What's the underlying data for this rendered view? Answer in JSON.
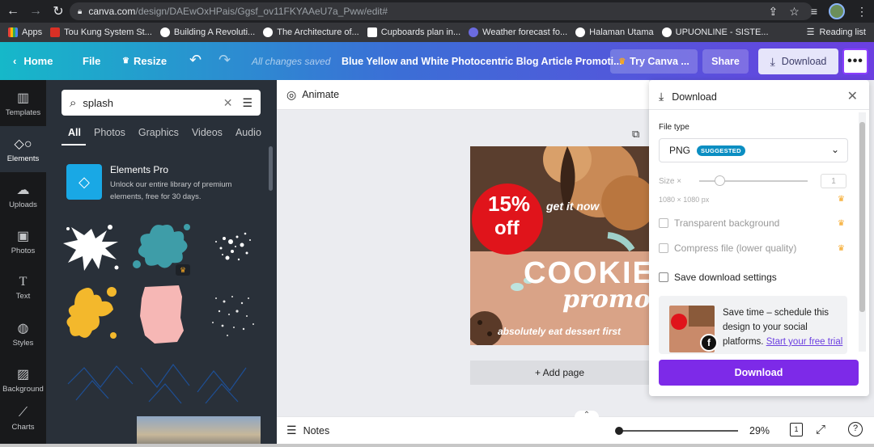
{
  "browser": {
    "url_host": "canva.com",
    "url_path": "/design/DAEwOxHPais/Ggsf_ov11FKYAAeU7a_Pww/edit#",
    "bookmarks": [
      {
        "label": "Apps",
        "color": "#e8eaed"
      },
      {
        "label": "Tou Kung System St...",
        "color": "#d93025"
      },
      {
        "label": "Building A Revoluti...",
        "color": "#4285f4"
      },
      {
        "label": "The Architecture of...",
        "color": "#4285f4"
      },
      {
        "label": "Cupboards plan in...",
        "color": "#ffffff"
      },
      {
        "label": "Weather forecast fo...",
        "color": "#6b6be0"
      },
      {
        "label": "Halaman Utama",
        "color": "#ffffff"
      },
      {
        "label": "UPUONLINE - SISTE...",
        "color": "#ffffff"
      }
    ],
    "reading_list": "Reading list"
  },
  "topbar": {
    "home": "Home",
    "file": "File",
    "resize": "Resize",
    "saved_status": "All changes saved",
    "title": "Blue Yellow and White Photocentric Blog Article Promoti...",
    "try_canva": "Try Canva ...",
    "share": "Share",
    "download": "Download",
    "more": "•••"
  },
  "rail": [
    {
      "label": "Templates",
      "icon": "templates-icon"
    },
    {
      "label": "Elements",
      "icon": "elements-icon"
    },
    {
      "label": "Uploads",
      "icon": "uploads-icon"
    },
    {
      "label": "Photos",
      "icon": "photos-icon"
    },
    {
      "label": "Text",
      "icon": "text-icon"
    },
    {
      "label": "Styles",
      "icon": "styles-icon"
    },
    {
      "label": "Background",
      "icon": "background-icon"
    },
    {
      "label": "Charts",
      "icon": "charts-icon"
    }
  ],
  "panel": {
    "search_value": "splash",
    "tabs": [
      "All",
      "Photos",
      "Graphics",
      "Videos",
      "Audio"
    ],
    "promo_title": "Elements Pro",
    "promo_desc_1": "Unlock our entire library of premium",
    "promo_desc_2": "elements, free for 30 days."
  },
  "canvas": {
    "animate": "Animate",
    "add_page": "+ Add page",
    "notes": "Notes",
    "zoom": "29%",
    "page_num": "1",
    "design_text": {
      "discount_1": "15%",
      "discount_2": "off",
      "tagline": "get it now",
      "headline": "COOKIE",
      "headline_2": "promo",
      "footer": "absolutely eat dessert first"
    }
  },
  "download_panel": {
    "title": "Download",
    "file_type_label": "File type",
    "file_type": "PNG",
    "suggested": "SUGGESTED",
    "size_label": "Size ×",
    "size_value": "1",
    "dimensions": "1080 × 1080 px",
    "transparent_bg": "Transparent background",
    "compress": "Compress file (lower quality)",
    "save_settings": "Save download settings",
    "schedule_text": "Save time – schedule this design to your social platforms.",
    "schedule_link": "Start your free trial",
    "download_button": "Download"
  }
}
